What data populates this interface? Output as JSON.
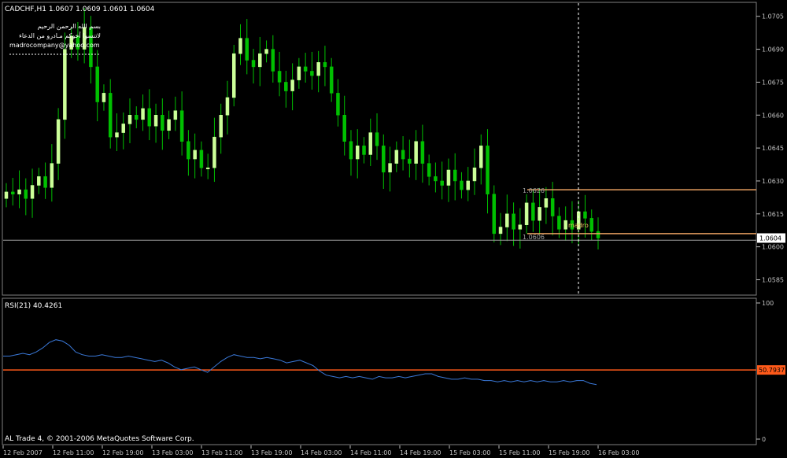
{
  "header": {
    "symbol_line": "CADCHF,H1  1.0607 1.0609 1.0601 1.0604",
    "note_line1": "بسم الله الرحمن الرحيم",
    "note_line2": "لاتنسوا أخوكم مـادرو من الدعاء",
    "note_email": "madrocompany@yahoo.com",
    "rsi_label": "RSI(21) 40.4261",
    "copyright": "AL Trade 4, © 2001-2006 MetaQuotes Software Corp."
  },
  "colors": {
    "background": "#000000",
    "bull_candle": "#ccff99",
    "bear_candle": "#00c000",
    "wick": "#00c000",
    "rsi_line": "#3a78d8",
    "rsi_level": "#ff5a1a",
    "level_line": "#e8a060",
    "price_line": "#a0a0a0",
    "axis": "#c0c0c0",
    "text": "#ffffff"
  },
  "chart_data": [
    {
      "type": "candlestick",
      "symbol": "CADCHF",
      "timeframe": "H1",
      "ohlc_header": {
        "open": 1.0607,
        "high": 1.0609,
        "low": 1.0601,
        "close": 1.0604
      },
      "ylim": [
        1.0578,
        1.0711
      ],
      "y_ticks": [
        "1.0705",
        "1.0690",
        "1.0675",
        "1.0660",
        "1.0645",
        "1.0630",
        "1.0615",
        "1.0600",
        "1.0585"
      ],
      "x_ticks": [
        "12 Feb 2007",
        "12 Feb 11:00",
        "12 Feb 19:00",
        "13 Feb 03:00",
        "13 Feb 11:00",
        "13 Feb 19:00",
        "14 Feb 03:00",
        "14 Feb 11:00",
        "14 Feb 19:00",
        "15 Feb 03:00",
        "15 Feb 11:00",
        "15 Feb 19:00",
        "16 Feb 03:00"
      ],
      "current_price": "1.0604",
      "levels": [
        {
          "label": "1.0626",
          "value": 1.0626
        },
        {
          "label": "1.0606",
          "value": 1.0606
        }
      ],
      "marker_label": "madro",
      "grid": false,
      "series_close": [
        1.0625,
        1.0624,
        1.0626,
        1.0622,
        1.0628,
        1.0632,
        1.0627,
        1.0638,
        1.0658,
        1.069,
        1.0696,
        1.069,
        1.07,
        1.0682,
        1.0666,
        1.067,
        1.065,
        1.0652,
        1.0656,
        1.066,
        1.0658,
        1.0663,
        1.0655,
        1.066,
        1.0653,
        1.0658,
        1.0662,
        1.0648,
        1.064,
        1.0644,
        1.0636,
        1.0636,
        1.065,
        1.066,
        1.0668,
        1.0688,
        1.0695,
        1.0685,
        1.0682,
        1.0688,
        1.069,
        1.068,
        1.0675,
        1.0671,
        1.0676,
        1.0682,
        1.068,
        1.0678,
        1.0684,
        1.0682,
        1.067,
        1.066,
        1.0648,
        1.064,
        1.0646,
        1.0642,
        1.0652,
        1.0646,
        1.0634,
        1.0638,
        1.0644,
        1.064,
        1.0638,
        1.0648,
        1.0638,
        1.0632,
        1.063,
        1.0628,
        1.0635,
        1.063,
        1.0626,
        1.063,
        1.0636,
        1.0646,
        1.0624,
        1.0606,
        1.0609,
        1.0615,
        1.0608,
        1.061,
        1.062,
        1.0612,
        1.0618,
        1.0622,
        1.0614,
        1.0608,
        1.0612,
        1.0608,
        1.0616,
        1.0613,
        1.0607,
        1.0604
      ]
    },
    {
      "type": "line",
      "name": "RSI(21)",
      "current_value": "40.4261",
      "ylim": [
        0,
        100
      ],
      "y_ticks": [
        "100",
        "0"
      ],
      "level_label": "50.7937",
      "level_value": 50.7937,
      "series": [
        {
          "values": [
            61,
            61,
            62,
            63,
            62,
            64,
            67,
            71,
            73,
            72,
            69,
            64,
            62,
            61,
            61,
            62,
            61,
            60,
            60,
            61,
            60,
            59,
            58,
            57,
            58,
            56,
            53,
            51,
            52,
            53,
            51,
            49,
            53,
            57,
            60,
            62,
            61,
            60,
            60,
            59,
            60,
            59,
            58,
            56,
            57,
            58,
            56,
            54,
            50,
            47,
            46,
            45,
            46,
            45,
            46,
            45,
            44,
            46,
            45,
            45,
            46,
            45,
            46,
            47,
            48,
            48,
            46,
            45,
            44,
            44,
            45,
            44,
            44,
            43,
            43,
            42,
            43,
            42,
            43,
            42,
            43,
            42,
            43,
            42,
            42,
            43,
            42,
            43,
            43,
            41,
            40
          ]
        }
      ]
    }
  ]
}
